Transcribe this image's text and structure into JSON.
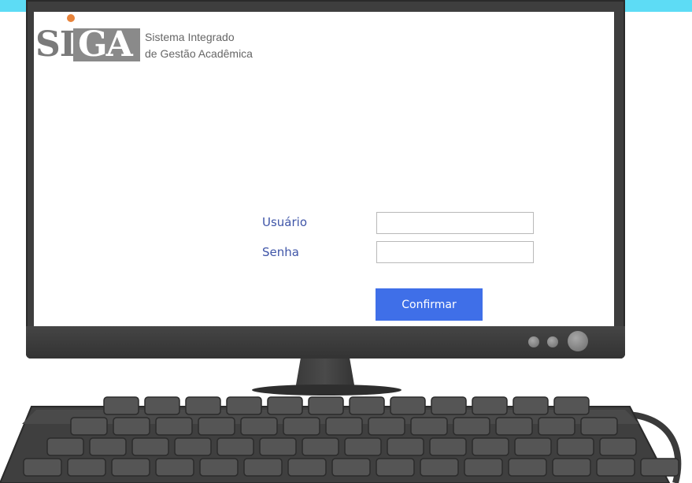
{
  "logo": {
    "mark_prefix": "SI",
    "mark_box": "GA",
    "line1": "Sistema Integrado",
    "line2": "de Gestão Acadêmica",
    "accent_color": "#e8833a"
  },
  "login": {
    "user_label": "Usuário",
    "user_value": "",
    "password_label": "Senha",
    "password_value": "",
    "confirm_label": "Confirmar"
  },
  "colors": {
    "top_bar": "#5ddcf5",
    "label": "#3f55a8",
    "button": "#3f6fe8",
    "bezel": "#3e3e3e"
  },
  "icons": {
    "monitor": "monitor-illustration-icon",
    "keyboard": "keyboard-illustration-icon",
    "indicator": "indicator-light-icon"
  }
}
